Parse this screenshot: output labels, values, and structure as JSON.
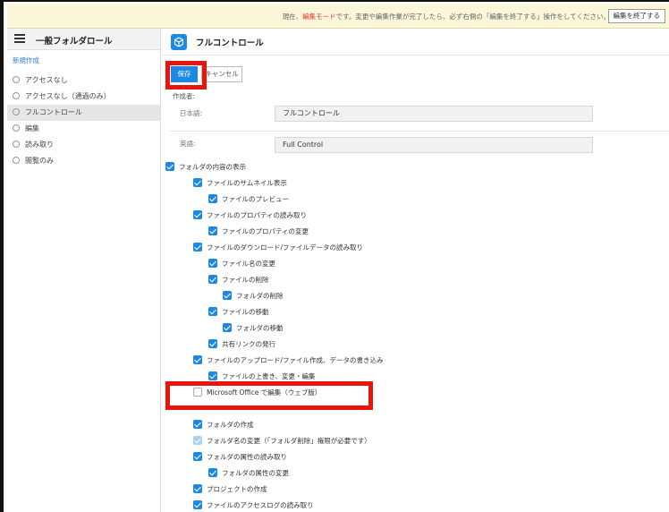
{
  "notice": {
    "before": "現在、",
    "highlight": "編集モード",
    "after": "です。変更や編集作業が完了したら、必ず右側の「編集を終了する」操作をしてください。",
    "button": "編集を終了する"
  },
  "sidebar": {
    "title": "一般フォルダロール",
    "new_link": "新規作成",
    "items": [
      {
        "label": "アクセスなし"
      },
      {
        "label": "アクセスなし（通過のみ）"
      },
      {
        "label": "フルコントロール"
      },
      {
        "label": "編集"
      },
      {
        "label": "読み取り"
      },
      {
        "label": "閲覧のみ"
      }
    ]
  },
  "main": {
    "title": "フルコントロール",
    "save_label": "保存",
    "cancel_label": "キャンセル",
    "creator_label": "作成者:",
    "japanese_label": "日本語:",
    "japanese_value": "フルコントロール",
    "english_label": "英語:",
    "english_value": "Full Control"
  },
  "permissions": [
    {
      "label": "フォルダの内容の表示",
      "state": "checked"
    },
    {
      "label": "ファイルのサムネイル表示",
      "state": "checked"
    },
    {
      "label": "ファイルのプレビュー",
      "state": "checked"
    },
    {
      "label": "ファイルのプロパティの読み取り",
      "state": "checked"
    },
    {
      "label": "ファイルのプロパティの変更",
      "state": "checked"
    },
    {
      "label": "ファイルのダウンロード/ファイルデータの読み取り",
      "state": "checked"
    },
    {
      "label": "ファイル名の変更",
      "state": "checked"
    },
    {
      "label": "ファイルの削除",
      "state": "checked"
    },
    {
      "label": "フォルダの削除",
      "state": "checked"
    },
    {
      "label": "ファイルの移動",
      "state": "checked"
    },
    {
      "label": "フォルダの移動",
      "state": "checked"
    },
    {
      "label": "共有リンクの発行",
      "state": "checked"
    },
    {
      "label": "ファイルのアップロード/ファイル作成、データの書き込み",
      "state": "checked"
    },
    {
      "label": "ファイルの上書き、変更・編集",
      "state": "checked"
    },
    {
      "label": "Microsoft Office で編集（ウェブ版）",
      "state": "unchecked"
    },
    {
      "label": "フォルダの作成",
      "state": "checked"
    },
    {
      "label": "フォルダ名の変更（「フォルダ削除」権限が必要です）",
      "state": "disabled"
    },
    {
      "label": "フォルダの属性の読み取り",
      "state": "checked"
    },
    {
      "label": "フォルダの属性の変更",
      "state": "checked"
    },
    {
      "label": "プロジェクトの作成",
      "state": "checked"
    },
    {
      "label": "ファイルのアクセスログの読み取り",
      "state": "checked"
    }
  ]
}
